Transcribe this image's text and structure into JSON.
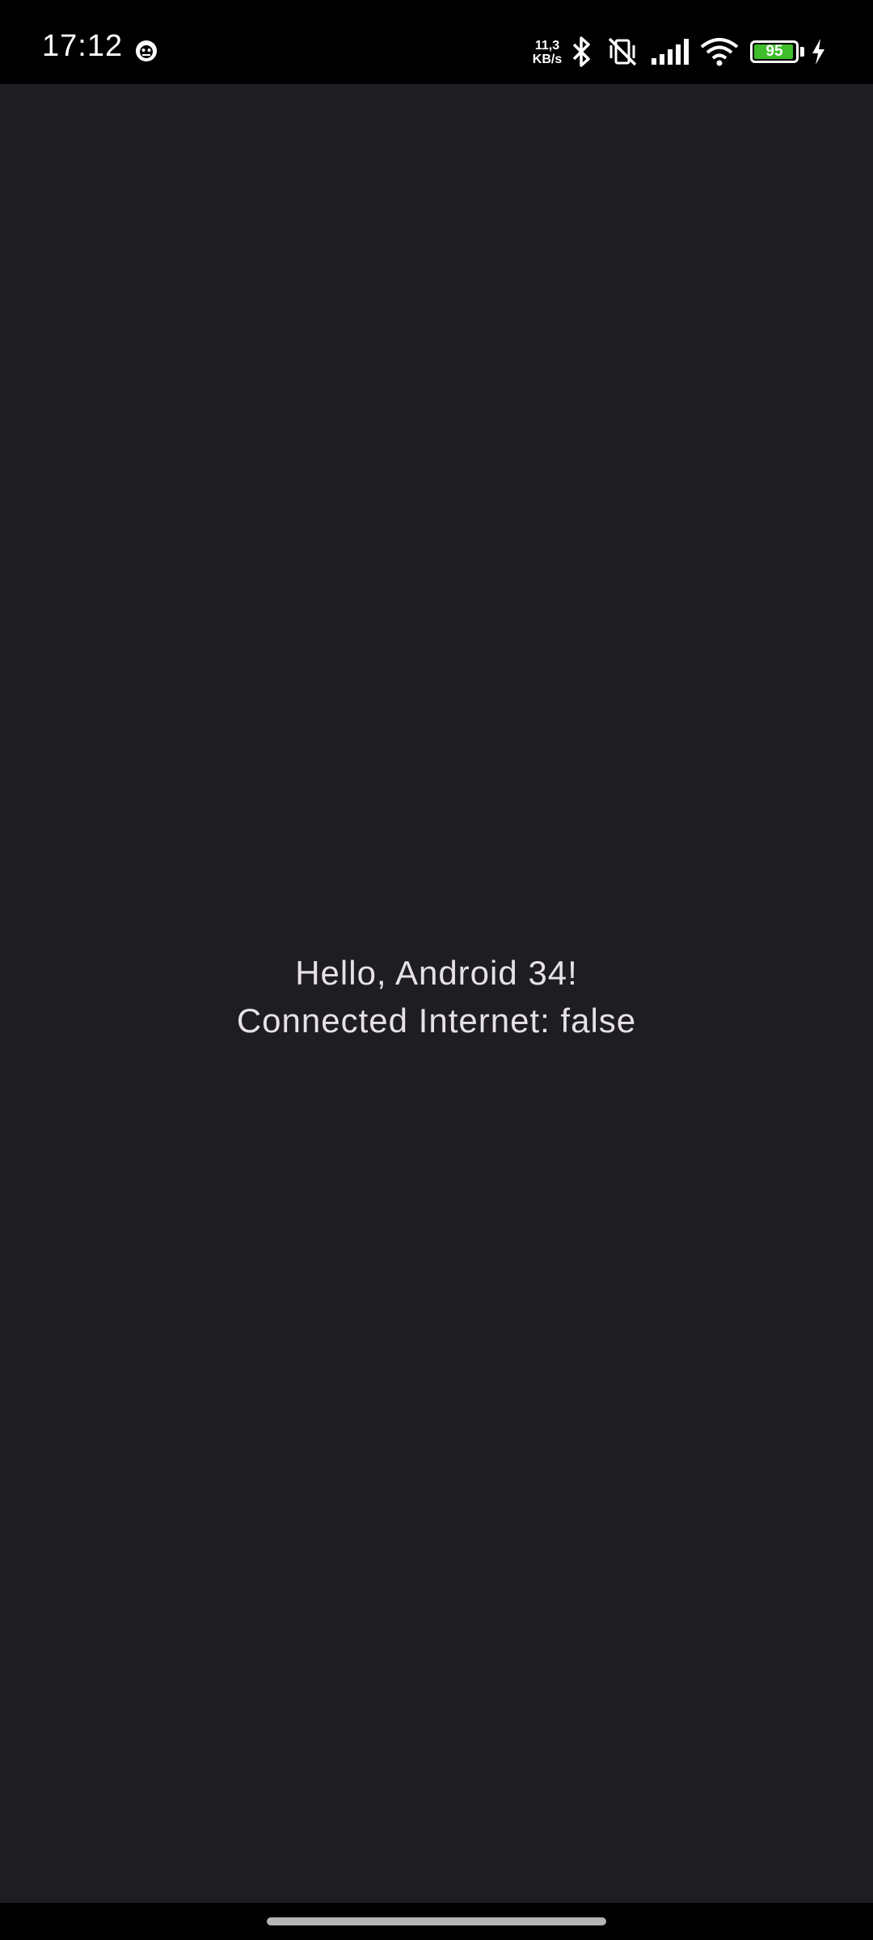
{
  "status_bar": {
    "time": "17:12",
    "net_speed_value": "11,3",
    "net_speed_unit": "KB/s",
    "battery_level": "95",
    "icons": [
      "notification-app-icon",
      "bluetooth-icon",
      "vibrate-off-icon",
      "signal-icon",
      "wifi-icon",
      "battery-icon",
      "charging-icon"
    ]
  },
  "main": {
    "greeting": "Hello, Android 34!",
    "connection_status": "Connected Internet: false"
  },
  "colors": {
    "background": "#1e1d22",
    "text": "#e6e1e6",
    "battery_fill": "#3fbd2b"
  }
}
